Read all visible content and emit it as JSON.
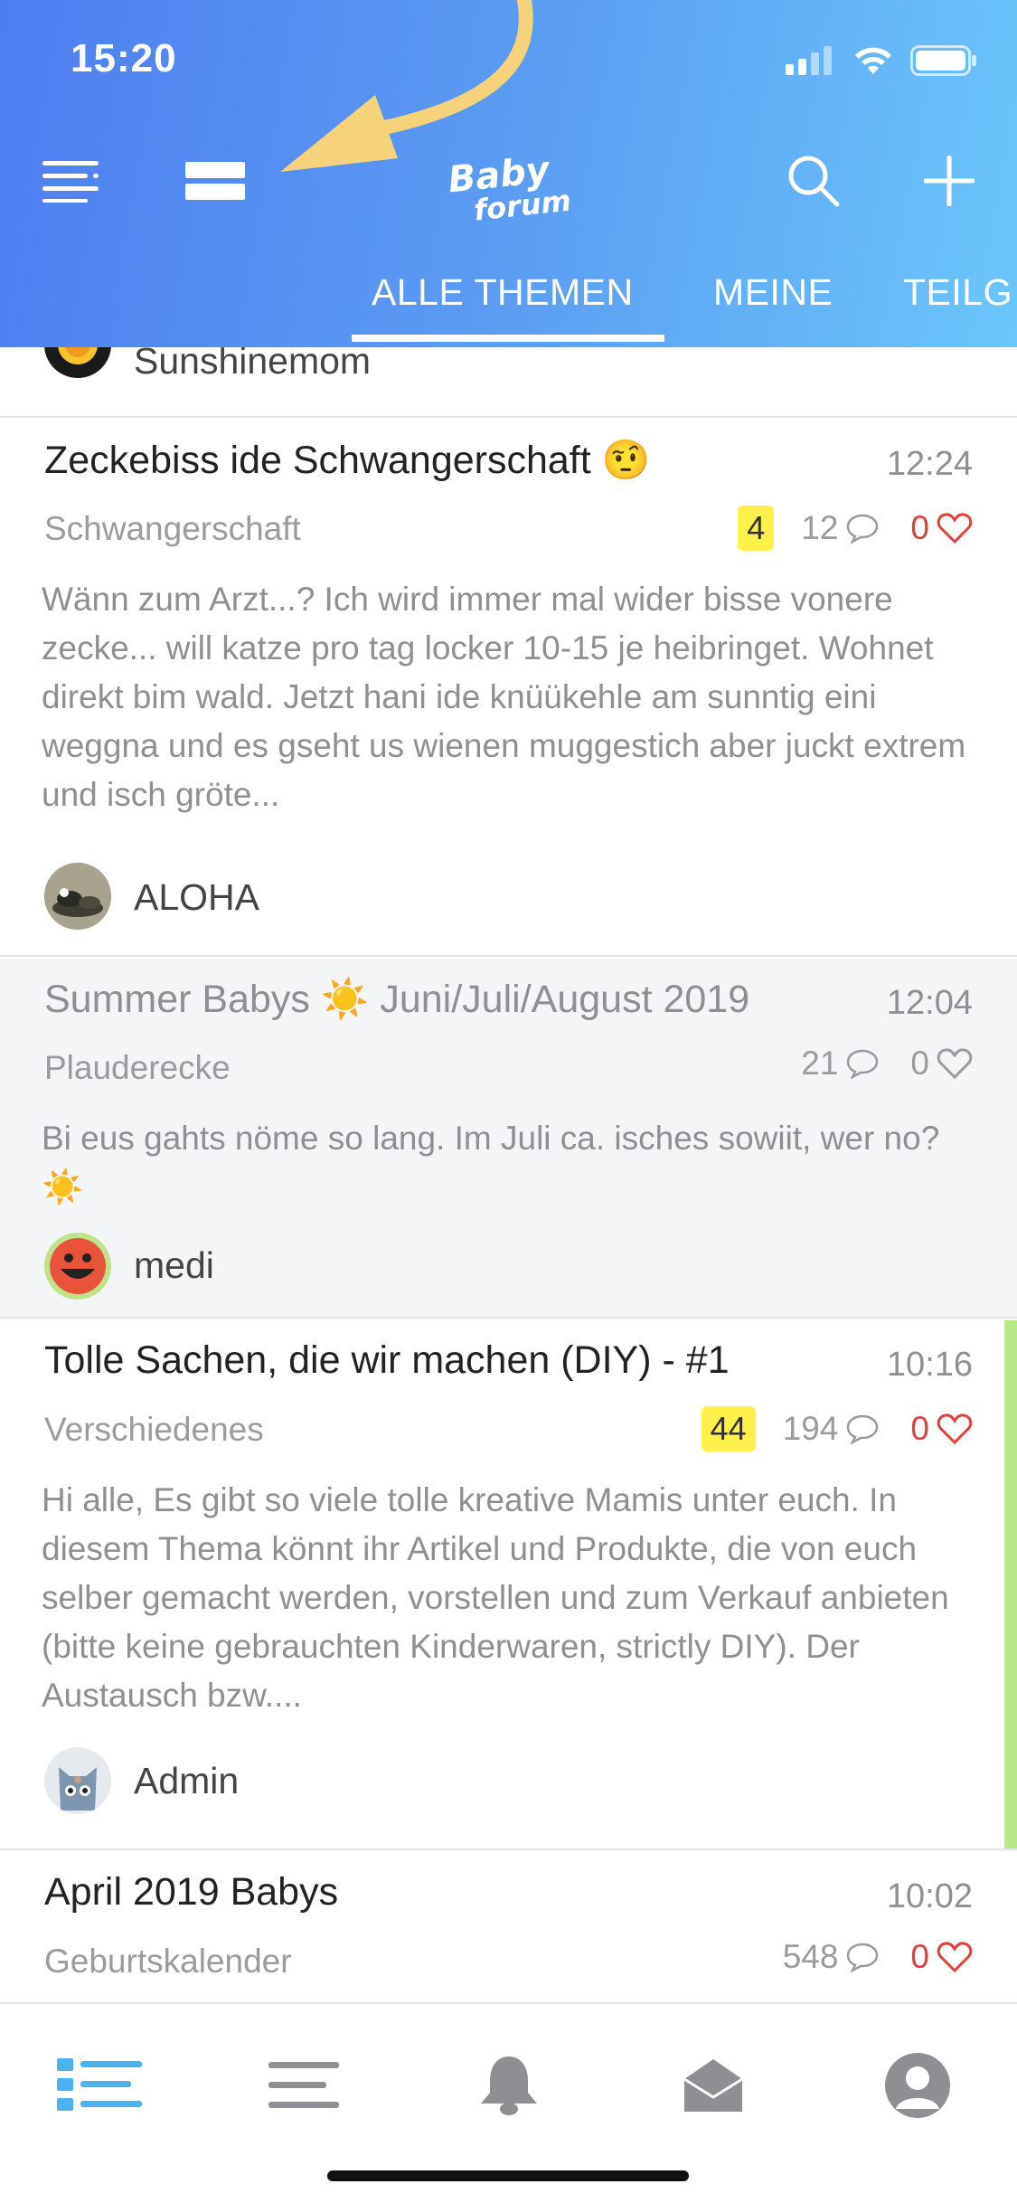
{
  "status_bar": {
    "time": "15:20"
  },
  "header": {
    "logo_text": "Baby Forum",
    "tabs": [
      {
        "label": "ALLE THEMEN",
        "active": true
      },
      {
        "label": "MEINE",
        "active": false
      },
      {
        "label": "TEILG",
        "active": false
      }
    ]
  },
  "colors": {
    "accent_gradient_start": "#4d7ef0",
    "accent_gradient_end": "#6bc6fb",
    "badge_yellow": "#fff04a",
    "like_red": "#e0403a",
    "pinned_green": "#b8e986",
    "arrow_annotation": "#f6d37b"
  },
  "previous_post_author": "Sunshinemom",
  "posts": [
    {
      "title": "Zeckebiss ide Schwangerschaft 🤨",
      "time": "12:24",
      "category": "Schwangerschaft",
      "badge": "4",
      "replies": "12",
      "likes": "0",
      "excerpt": "Wänn zum Arzt...? Ich wird immer mal wider bisse vonere zecke... will katze pro tag locker 10-15 je heibringet. Wohnet direkt bim wald. Jetzt hani ide knüükehle am sunntig eini weggna und es gseht us wienen muggestich aber juckt extrem und isch gröte...",
      "author": "ALOHA"
    },
    {
      "title": "Summer Babys ☀️ Juni/Juli/August 2019",
      "time": "12:04",
      "category": "Plauderecke",
      "badge": "",
      "replies": "21",
      "likes": "0",
      "excerpt": "Bi eus gahts nöme so lang. Im Juli ca. isches sowiit, wer no? ☀️",
      "author": "medi"
    },
    {
      "title": "Tolle Sachen, die wir machen (DIY) - #1",
      "time": "10:16",
      "category": "Verschiedenes",
      "badge": "44",
      "replies": "194",
      "likes": "0",
      "excerpt": "Hi alle, Es gibt so viele tolle kreative Mamis unter euch. In diesem Thema könnt ihr Artikel und Produkte, die von euch selber gemacht werden, vorstellen und zum Verkauf anbieten (bitte keine gebrauchten Kinderwaren, strictly DIY). Der Austausch bzw....",
      "author": "Admin"
    },
    {
      "title": "April 2019 Babys",
      "time": "10:02",
      "category": "Geburtskalender",
      "badge": "",
      "replies": "548",
      "likes": "0",
      "excerpt": "",
      "author": ""
    }
  ],
  "tabbar_icons": [
    "topics-list-icon",
    "menu-lines-icon",
    "bell-icon",
    "envelope-icon",
    "profile-icon"
  ]
}
